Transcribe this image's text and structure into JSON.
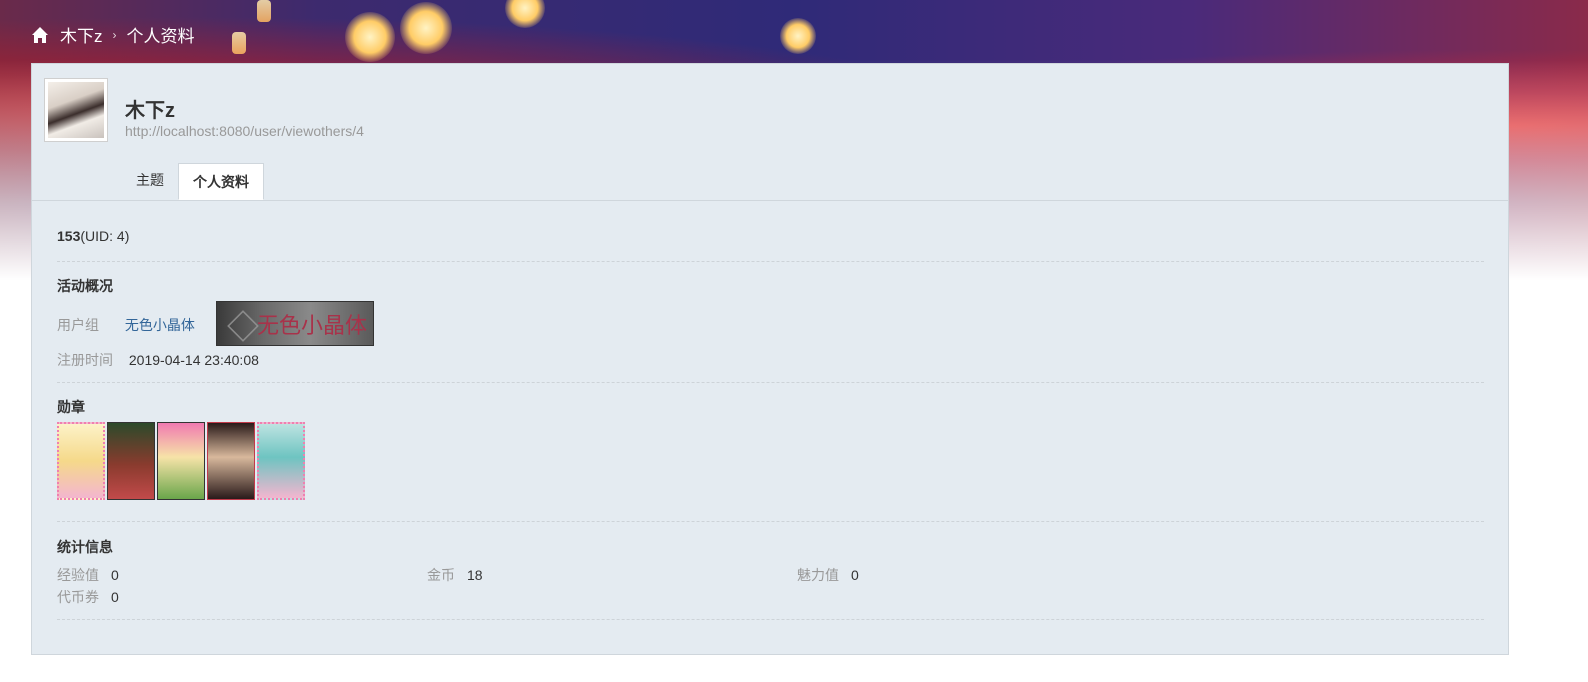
{
  "breadcrumb": {
    "user": "木下z",
    "separator": "›",
    "current": "个人资料"
  },
  "profile": {
    "name": "木下z",
    "url": "http://localhost:8080/user/viewothers/4"
  },
  "tabs": [
    {
      "label": "主题",
      "active": false
    },
    {
      "label": "个人资料",
      "active": true
    }
  ],
  "basic": {
    "number": "153",
    "uid": "(UID: 4)"
  },
  "activity": {
    "title": "活动概况",
    "group_label": "用户组",
    "group_value": "无色小晶体",
    "group_badge_text": "无色小晶体",
    "register_label": "注册时间",
    "register_value": "2019-04-14 23:40:08"
  },
  "medals": {
    "title": "勋章",
    "count": 5
  },
  "stats": {
    "title": "统计信息",
    "items": [
      {
        "label": "经验值",
        "value": "0"
      },
      {
        "label": "金币",
        "value": "18"
      },
      {
        "label": "魅力值",
        "value": "0"
      },
      {
        "label": "代币券",
        "value": "0"
      }
    ]
  },
  "colors": {
    "panel_bg": "#e4ebf1",
    "link": "#336699",
    "muted": "#999999"
  },
  "icons": [
    "home-icon"
  ]
}
